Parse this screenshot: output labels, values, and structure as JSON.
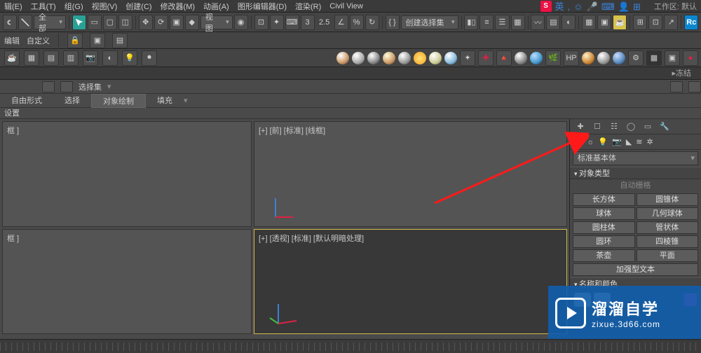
{
  "menu": {
    "edit": "辑(E)",
    "tool": "工具(T)",
    "group": "组(G)",
    "view": "视图(V)",
    "create": "创建(C)",
    "modifier": "修改器(M)",
    "anim": "动画(A)",
    "graph": "图形编辑器(D)",
    "render": "渲染(R)",
    "civil": "Civil View",
    "ime_text": "英",
    "workspace_label": "工作区:  默认"
  },
  "toolbar1": {
    "all": "全部",
    "view": "视图",
    "angle": "2.5",
    "selset": "创建选择集"
  },
  "row2": {
    "edit": "编辑",
    "custom": "自定义"
  },
  "freeze": "▸冻结",
  "ribbon": {
    "selset": "选择集",
    "freeform": "自由形式",
    "select": "选择",
    "objpaint": "对象绘制",
    "fill": "填充",
    "settings": "设置"
  },
  "viewports": {
    "tl": "框 ]",
    "bl": "框 ]",
    "tr": "[+] [前] [标准] [线框]",
    "br": "[+] [透视] [标准] [默认明暗处理]"
  },
  "panel": {
    "primitive": "标准基本体",
    "objtype": "对象类型",
    "autogrid": "自动栅格",
    "buttons": {
      "box": "长方体",
      "cone": "圆锥体",
      "sphere": "球体",
      "geosphere": "几何球体",
      "cylinder": "圆柱体",
      "tube": "管状体",
      "torus": "圆环",
      "pyramid": "四棱锥",
      "teapot": "茶壶",
      "plane": "平面",
      "textplus": "加强型文本"
    },
    "namecolor": "名称和颜色"
  },
  "watermark": {
    "big": "溜溜自学",
    "small": "zixue.3d66.com"
  },
  "rc": "Rc"
}
